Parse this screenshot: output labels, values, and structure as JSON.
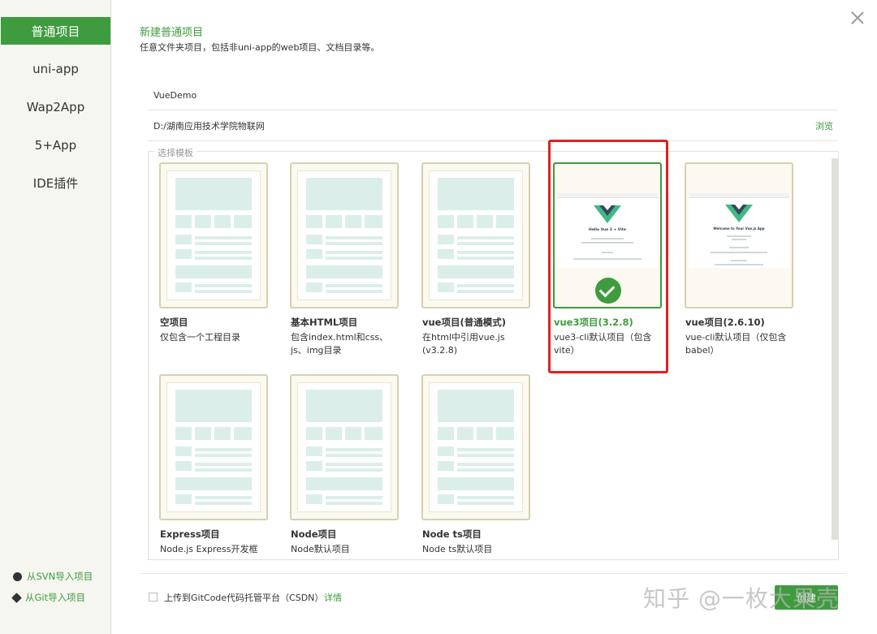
{
  "sidebar": {
    "items": [
      {
        "label": "普通项目",
        "active": true
      },
      {
        "label": "uni-app"
      },
      {
        "label": "Wap2App"
      },
      {
        "label": "5+App"
      },
      {
        "label": "IDE插件"
      }
    ],
    "svn_import": "从SVN导入项目",
    "git_import": "从Git导入项目"
  },
  "header": {
    "title": "新建普通项目",
    "subtitle": "任意文件夹项目，包括非uni-app的web项目、文档目录等。"
  },
  "form": {
    "project_name": "VueDemo",
    "location": "D:/湖南应用技术学院物联网",
    "browse_label": "浏览"
  },
  "templates": {
    "legend": "选择模板",
    "items": [
      {
        "title": "空项目",
        "desc": "仅包含一个工程目录"
      },
      {
        "title": "基本HTML项目",
        "desc": "包含index.html和css、js、img目录"
      },
      {
        "title": "vue项目(普通模式)",
        "desc": "在html中引用vue.js (v3.2.8)"
      },
      {
        "title": "vue3项目(3.2.8)",
        "desc": "vue3-cli默认项目（包含vite）",
        "selected": true
      },
      {
        "title": "vue项目(2.6.10)",
        "desc": "vue-cli默认项目（仅包含babel）"
      },
      {
        "title": "Express项目",
        "desc": "Node.js Express开发框架默认项目"
      },
      {
        "title": "Node项目",
        "desc": "Node默认项目"
      },
      {
        "title": "Node ts项目",
        "desc": "Node ts默认项目"
      }
    ],
    "vue3_preview_title": "Hello Vue 3 + Vite",
    "vue2_preview_title": "Welcome to Your Vue.js App"
  },
  "footer": {
    "upload_label": "上传到GitCode代码托管平台（CSDN）",
    "upload_link": "详情",
    "create_label": "创建"
  },
  "watermark": "知乎 @一枚大果壳",
  "colors": {
    "accent": "#3e9b3e",
    "highlight_box": "#e02020",
    "thumb_block": "#dbeeea"
  }
}
